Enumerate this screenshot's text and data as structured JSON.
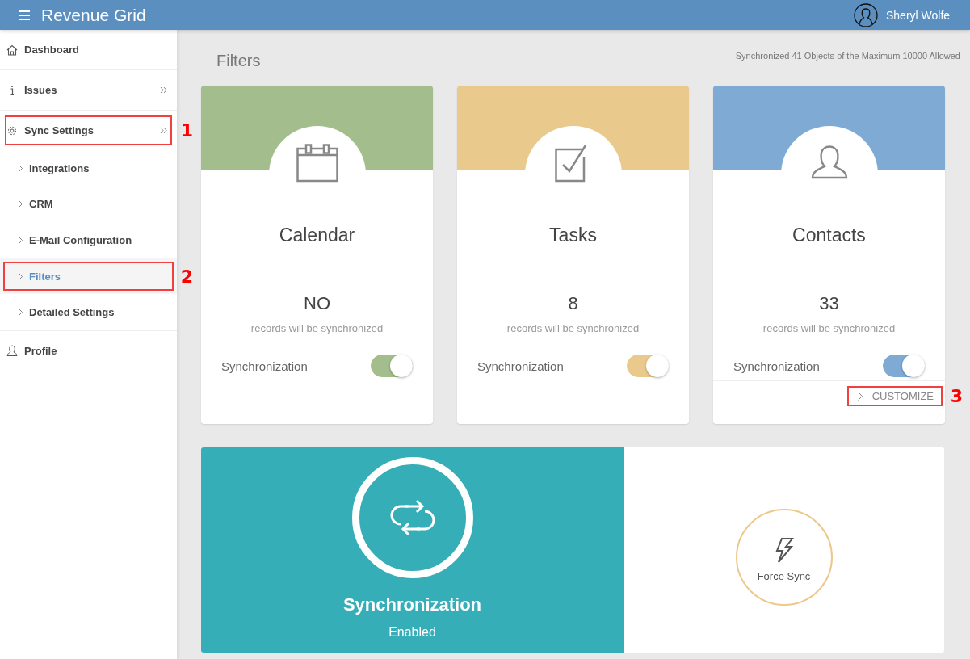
{
  "header": {
    "app_title": "Revenue Grid",
    "user_name": "Sheryl Wolfe"
  },
  "sidebar": {
    "items": [
      {
        "label": "Dashboard",
        "kind": "home",
        "selected": false,
        "expandable": false
      },
      {
        "label": "Issues",
        "kind": "info",
        "selected": false,
        "expandable": true
      },
      {
        "label": "Sync Settings",
        "kind": "settings",
        "selected": false,
        "expandable": true,
        "callout": "1",
        "children": [
          {
            "label": "Integrations",
            "selected": false
          },
          {
            "label": "CRM",
            "selected": false
          },
          {
            "label": "E-Mail Configuration",
            "selected": false
          },
          {
            "label": "Filters",
            "selected": true,
            "callout": "2"
          },
          {
            "label": "Detailed Settings",
            "selected": false
          }
        ]
      },
      {
        "label": "Profile",
        "kind": "profile",
        "selected": false,
        "expandable": false
      }
    ]
  },
  "page_title": "Filters",
  "sync_summary": "Synchronized 41 Objects of the Maximum 10000 Allowed",
  "cards": [
    {
      "kind": "calendar",
      "title": "Calendar",
      "count": "NO",
      "caption": "records will be synchronized",
      "toggle_label": "Synchronization",
      "on": true,
      "color": "#a3be8c"
    },
    {
      "kind": "tasks",
      "title": "Tasks",
      "count": "8",
      "caption": "records will be synchronized",
      "toggle_label": "Synchronization",
      "on": true,
      "color": "#e9ca8c"
    },
    {
      "kind": "contacts",
      "title": "Contacts",
      "count": "33",
      "caption": "records will be synchronized",
      "toggle_label": "Synchronization",
      "on": true,
      "color": "#7eaad3",
      "customize": {
        "label": "CUSTOMIZE",
        "callout": "3"
      }
    }
  ],
  "sync_status": {
    "title": "Synchronization",
    "state": "Enabled",
    "enabled": true
  },
  "force_sync": {
    "label": "Force Sync"
  }
}
